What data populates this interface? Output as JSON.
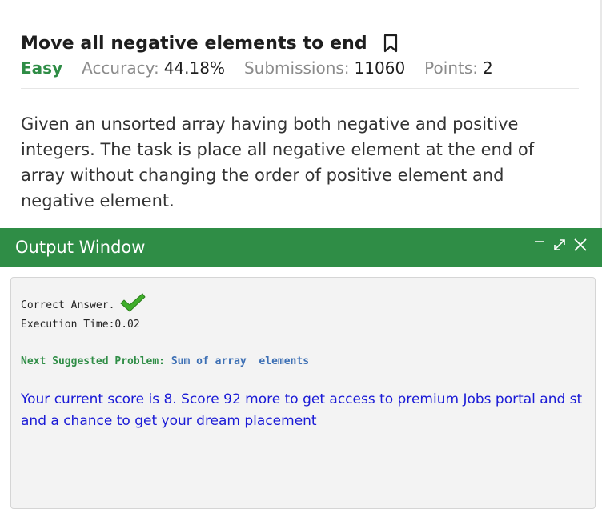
{
  "problem": {
    "title": "Move all negative elements to end",
    "difficulty": "Easy",
    "accuracy_label": "Accuracy:",
    "accuracy_value": "44.18%",
    "submissions_label": "Submissions:",
    "submissions_value": "11060",
    "points_label": "Points:",
    "points_value": "2",
    "description": "Given an unsorted array having both negative and positive integers. The task is place all negative element at the end of array without changing the order of positive element and negative element."
  },
  "output_window": {
    "title": "Output Window",
    "minimize_icon": "minimize-icon",
    "expand_icon": "expand-icon",
    "close_icon": "close-icon",
    "correct_text": "Correct Answer.",
    "check_icon": "checkmark-icon",
    "execution_time": "Execution Time:0.02",
    "next_label": "Next Suggested Problem:",
    "next_problem": "Sum of array  elements",
    "score_message": "Your current score is 8. Score 92 more to get access to premium Jobs portal and stand a chance to get your dream placement"
  },
  "colors": {
    "brand_green": "#2f8d46",
    "link_blue": "#3c6fb4",
    "score_blue": "#1a1ad6"
  }
}
